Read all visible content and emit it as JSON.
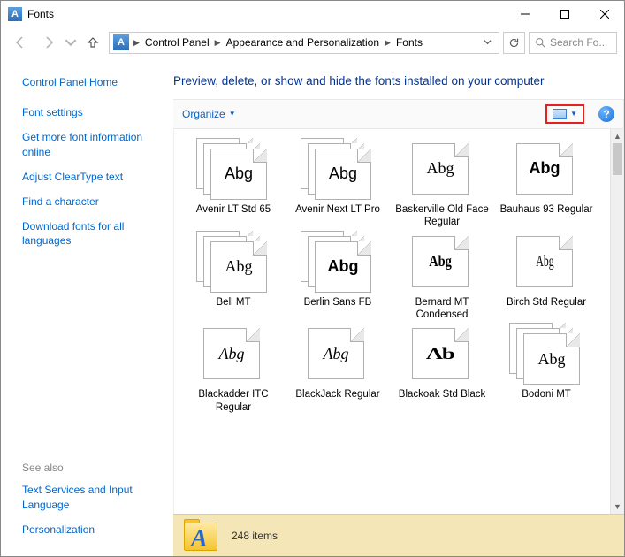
{
  "window": {
    "title": "Fonts"
  },
  "breadcrumb": {
    "segments": [
      "Control Panel",
      "Appearance and Personalization",
      "Fonts"
    ]
  },
  "search": {
    "placeholder": "Search Fo..."
  },
  "sidebar": {
    "home": "Control Panel Home",
    "links": [
      "Font settings",
      "Get more font information online",
      "Adjust ClearType text",
      "Find a character",
      "Download fonts for all languages"
    ],
    "see_also_label": "See also",
    "see_also": [
      "Text Services and Input Language",
      "Personalization"
    ]
  },
  "heading": "Preview, delete, or show and hide the fonts installed on your computer",
  "toolbar": {
    "organize": "Organize"
  },
  "fonts": [
    {
      "label": "Avenir LT Std 65",
      "sample": "Abg",
      "stack": 3,
      "style": "font-family:Avenir,'Century Gothic',sans-serif;"
    },
    {
      "label": "Avenir Next LT Pro",
      "sample": "Abg",
      "stack": 3,
      "style": "font-family:'Avenir Next','Century Gothic',sans-serif;"
    },
    {
      "label": "Baskerville Old Face Regular",
      "sample": "Abg",
      "stack": 1,
      "style": "font-family:'Baskerville Old Face',Baskerville,Georgia,serif;"
    },
    {
      "label": "Bauhaus 93 Regular",
      "sample": "Abg",
      "stack": 1,
      "style": "font-family:'Bauhaus 93','Arial Black',sans-serif;font-weight:900;"
    },
    {
      "label": "Bell MT",
      "sample": "Abg",
      "stack": 3,
      "style": "font-family:'Bell MT',Georgia,serif;"
    },
    {
      "label": "Berlin Sans FB",
      "sample": "Abg",
      "stack": 3,
      "style": "font-family:'Berlin Sans FB','Arial Black',sans-serif;font-weight:700;"
    },
    {
      "label": "Bernard MT Condensed",
      "sample": "Abg",
      "stack": 1,
      "style": "font-family:'Bernard MT Condensed','Arial Narrow',serif;font-weight:900;transform:scaleX(0.8);"
    },
    {
      "label": "Birch Std Regular",
      "sample": "Abg",
      "stack": 1,
      "style": "font-family:'Birch Std','Times New Roman',serif;transform:scaleX(0.65);"
    },
    {
      "label": "Blackadder ITC Regular",
      "sample": "Abg",
      "stack": 1,
      "style": "font-family:'Blackadder ITC','Brush Script MT',cursive;font-style:italic;"
    },
    {
      "label": "BlackJack Regular",
      "sample": "Abg",
      "stack": 1,
      "style": "font-family:'BlackJack','Brush Script MT',cursive;font-style:italic;"
    },
    {
      "label": "Blackoak Std Black",
      "sample": "Ab",
      "stack": 1,
      "style": "font-family:'Blackoak Std','Arial Black',serif;font-weight:900;transform:scaleX(1.5);letter-spacing:-1px;"
    },
    {
      "label": "Bodoni MT",
      "sample": "Abg",
      "stack": 3,
      "style": "font-family:'Bodoni MT','Didot',serif;"
    }
  ],
  "status": {
    "items": "248 items"
  }
}
